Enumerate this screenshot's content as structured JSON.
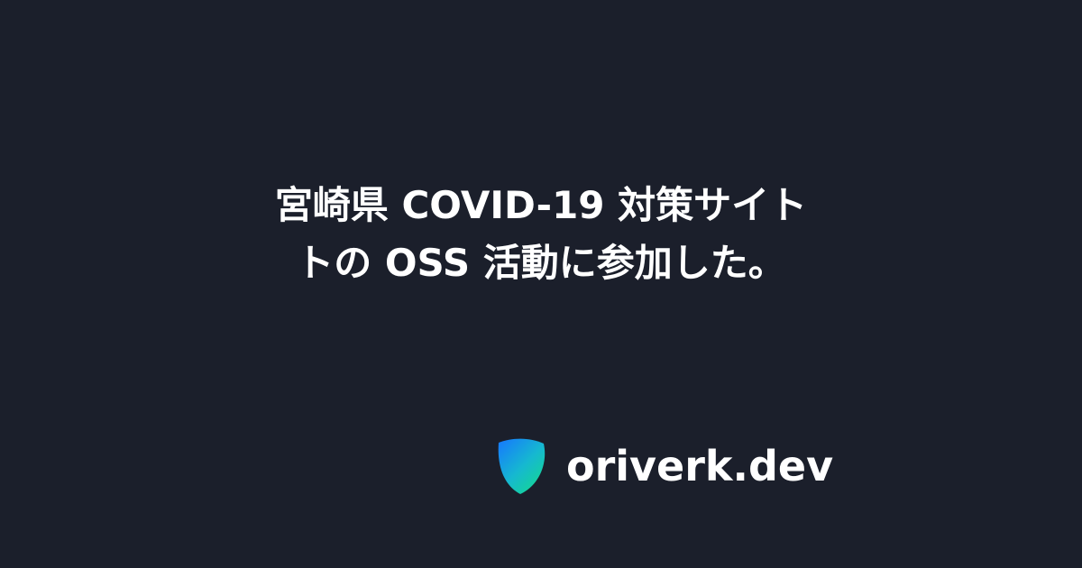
{
  "title": {
    "line1": "宮崎県 COVID-19 対策サイト",
    "line2": "トの OSS 活動に参加した。"
  },
  "brand": {
    "logo_icon": "shield-logo-icon",
    "site_name": "oriverk.dev"
  },
  "colors": {
    "background": "#1b1f2b",
    "text": "#ffffff",
    "logo_gradient_start": "#1677ff",
    "logo_gradient_end": "#14d98f"
  }
}
